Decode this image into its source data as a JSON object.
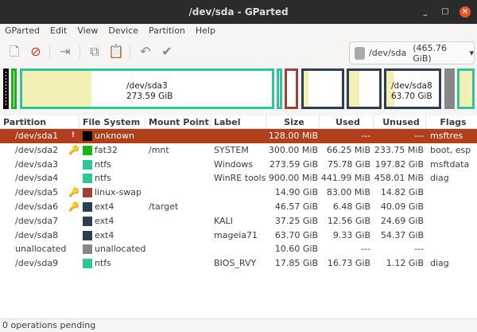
{
  "window": {
    "title": "/dev/sda - GParted",
    "minimize": "_",
    "maximize": "□",
    "close": "×"
  },
  "menu": [
    "GParted",
    "Edit",
    "View",
    "Device",
    "Partition",
    "Help"
  ],
  "toolbar": {
    "icons": [
      "new-icon",
      "delete-icon",
      "resize-move-icon",
      "copy-icon",
      "paste-icon",
      "undo-icon",
      "apply-icon"
    ]
  },
  "device": {
    "name": "/dev/sda",
    "size": "(465.76 GiB)",
    "arrow": "▾"
  },
  "diskmap": {
    "sda3": {
      "name": "/dev/sda3",
      "size": "273.59 GiB",
      "used_fraction": 0.277
    },
    "sda8": {
      "name": "/dev/sda8",
      "size": "63.70 GiB",
      "used_fraction": 0.146
    },
    "colors": {
      "ntfs": "#2fc49a",
      "fat32": "#18b418",
      "linux-swap": "#9c4237",
      "ext4": "#2c3e50",
      "unallocated": "#888888",
      "unknown": "#000000"
    }
  },
  "columns": [
    "Partition",
    "File System",
    "Mount Point",
    "Label",
    "Size",
    "Used",
    "Unused",
    "Flags"
  ],
  "rows": [
    {
      "partition": "/dev/sda1",
      "icon": "warning",
      "fs": "unknown",
      "color": "#000000",
      "mount": "",
      "label": "",
      "size": "128.00 MiB",
      "used": "---",
      "unused": "---",
      "flags": "msftres"
    },
    {
      "partition": "/dev/sda2",
      "icon": "key",
      "fs": "fat32",
      "color": "#18b418",
      "mount": "/mnt",
      "label": "SYSTEM",
      "size": "300.00 MiB",
      "used": "66.25 MiB",
      "unused": "233.75 MiB",
      "flags": "boot, esp"
    },
    {
      "partition": "/dev/sda3",
      "icon": "",
      "fs": "ntfs",
      "color": "#2fc49a",
      "mount": "",
      "label": "Windows",
      "size": "273.59 GiB",
      "used": "75.78 GiB",
      "unused": "197.82 GiB",
      "flags": "msftdata"
    },
    {
      "partition": "/dev/sda4",
      "icon": "",
      "fs": "ntfs",
      "color": "#2fc49a",
      "mount": "",
      "label": "WinRE tools",
      "size": "900.00 MiB",
      "used": "441.99 MiB",
      "unused": "458.01 MiB",
      "flags": "diag"
    },
    {
      "partition": "/dev/sda5",
      "icon": "key",
      "fs": "linux-swap",
      "color": "#9c4237",
      "mount": "",
      "label": "",
      "size": "14.90 GiB",
      "used": "83.00 MiB",
      "unused": "14.82 GiB",
      "flags": ""
    },
    {
      "partition": "/dev/sda6",
      "icon": "key",
      "fs": "ext4",
      "color": "#2c3e50",
      "mount": "/target",
      "label": "",
      "size": "46.57 GiB",
      "used": "6.48 GiB",
      "unused": "40.09 GiB",
      "flags": ""
    },
    {
      "partition": "/dev/sda7",
      "icon": "",
      "fs": "ext4",
      "color": "#2c3e50",
      "mount": "",
      "label": "KALI",
      "size": "37.25 GiB",
      "used": "12.56 GiB",
      "unused": "24.69 GiB",
      "flags": ""
    },
    {
      "partition": "/dev/sda8",
      "icon": "",
      "fs": "ext4",
      "color": "#2c3e50",
      "mount": "",
      "label": "mageia71",
      "size": "63.70 GiB",
      "used": "9.33 GiB",
      "unused": "54.37 GiB",
      "flags": ""
    },
    {
      "partition": "unallocated",
      "icon": "",
      "fs": "unallocated",
      "color": "#888888",
      "mount": "",
      "label": "",
      "size": "10.60 GiB",
      "used": "---",
      "unused": "---",
      "flags": ""
    },
    {
      "partition": "/dev/sda9",
      "icon": "",
      "fs": "ntfs",
      "color": "#2fc49a",
      "mount": "",
      "label": "BIOS_RVY",
      "size": "17.85 GiB",
      "used": "16.73 GiB",
      "unused": "1.12 GiB",
      "flags": "diag"
    }
  ],
  "status": "0 operations pending"
}
